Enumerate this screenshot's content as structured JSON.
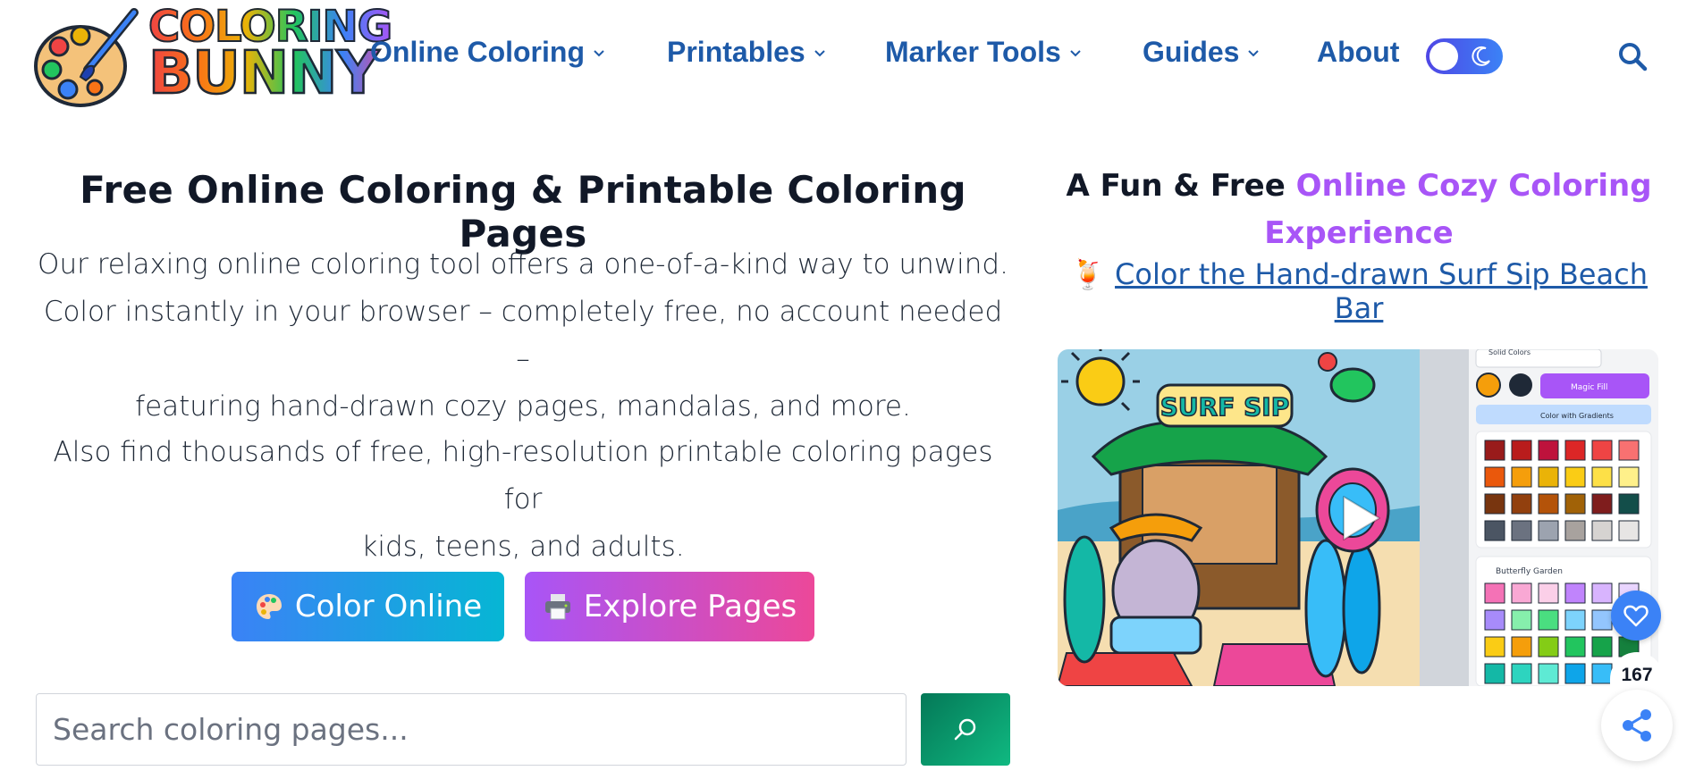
{
  "brand": {
    "logo_line1": "COLORING",
    "logo_line2": "BUNNY"
  },
  "nav": {
    "items": [
      {
        "label": "Online Coloring",
        "has_dropdown": true
      },
      {
        "label": "Printables",
        "has_dropdown": true
      },
      {
        "label": "Marker Tools",
        "has_dropdown": true
      },
      {
        "label": "Guides",
        "has_dropdown": true
      },
      {
        "label": "About",
        "has_dropdown": false
      }
    ],
    "theme_toggle_icon": "moon-icon",
    "search_icon": "search-icon"
  },
  "hero": {
    "title": "Free Online Coloring & Printable Coloring Pages",
    "description_line1": "Our relaxing online coloring tool offers a one-of-a-kind way to unwind.",
    "description_line2": "Color instantly in your browser – completely free, no account needed –",
    "description_line3": "featuring hand-drawn cozy pages, mandalas, and more.",
    "description2_line1": "Also find thousands of free, high-resolution printable coloring pages for",
    "description2_line2": "kids, teens, and adults."
  },
  "buttons": {
    "color_online": {
      "label": "Color Online",
      "icon": "palette-icon"
    },
    "explore_pages": {
      "label": "Explore Pages",
      "icon": "printer-icon"
    }
  },
  "search": {
    "placeholder": "Search coloring pages..."
  },
  "sidebar": {
    "title_prefix": "A Fun & Free ",
    "title_accent": "Online Cozy Coloring Experience",
    "link_emoji": "🍹",
    "link_text": "Color the Hand-drawn Surf Sip Beach Bar",
    "video_sign": "SURF SIP",
    "video_panel": {
      "solid_colors": "Solid Colors",
      "magic_fill": "Magic Fill",
      "gradients": "Color with Gradients",
      "palette_name": "Butterfly Garden"
    }
  },
  "floating": {
    "favorite_icon": "heart-icon",
    "count": "167",
    "share_icon": "share-icon"
  },
  "colors": {
    "nav_blue": "#1e5aa8",
    "accent_purple": "#a855f7",
    "search_green": "#059669"
  }
}
